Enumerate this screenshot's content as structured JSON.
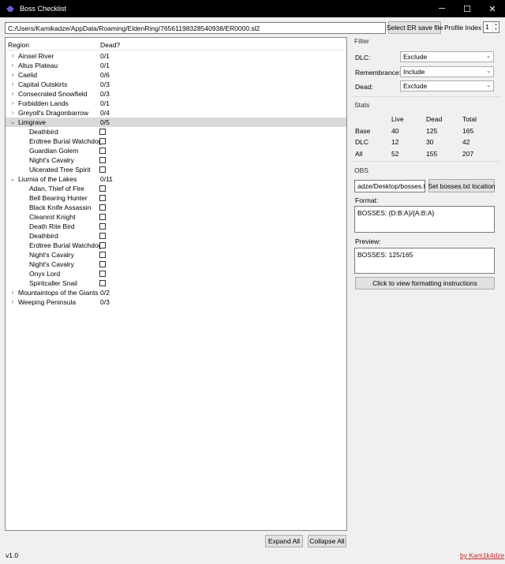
{
  "window": {
    "title": "Boss Checklist",
    "controls": [
      "─",
      "☐",
      "✕"
    ]
  },
  "toolbar": {
    "save_path": "C:/Users/Kamikadze/AppData/Roaming/EldenRing/76561198328540938/ER0000.sl2",
    "select_button": "Select ER save file",
    "profile_label": "Profile Index",
    "profile_value": "1"
  },
  "tree": {
    "headers": {
      "region": "Region",
      "dead": "Dead?"
    },
    "regions": [
      {
        "name": "Ainsel River",
        "count": "0/1",
        "expanded": false
      },
      {
        "name": "Altus Plateau",
        "count": "0/1",
        "expanded": false
      },
      {
        "name": "Caelid",
        "count": "0/6",
        "expanded": false
      },
      {
        "name": "Capital Outskirts",
        "count": "0/3",
        "expanded": false
      },
      {
        "name": "Consecrated Snowfield",
        "count": "0/3",
        "expanded": false
      },
      {
        "name": "Forbidden Lands",
        "count": "0/1",
        "expanded": false
      },
      {
        "name": "Greyoll's Dragonbarrow",
        "count": "0/4",
        "expanded": false
      },
      {
        "name": "Limgrave",
        "count": "0/5",
        "expanded": true,
        "selected": true,
        "bosses": [
          "Deathbird",
          "Erdtree Burial Watchdog",
          "Guardian Golem",
          "Night's Cavalry",
          "Ulcerated Tree Spirit"
        ]
      },
      {
        "name": "Liurnia of the Lakes",
        "count": "0/11",
        "expanded": true,
        "bosses": [
          "Adan, Thief of Fire",
          "Bell Bearing Hunter",
          "Black Knife Assassin",
          "Cleanrot Knight",
          "Death Rite Bird",
          "Deathbird",
          "Erdtree Burial Watchdog",
          "Night's Cavalry",
          "Night's Cavalry",
          "Onyx Lord",
          "Spiritcaller Snail"
        ]
      },
      {
        "name": "Mountaintops of the Giants",
        "count": "0/2",
        "expanded": false
      },
      {
        "name": "Weeping Peninsula",
        "count": "0/3",
        "expanded": false
      }
    ],
    "expand_all": "Expand All",
    "collapse_all": "Collapse All"
  },
  "filter": {
    "title": "Filter",
    "dlc_label": "DLC:",
    "dlc_value": "Exclude",
    "remembrance_label": "Remembrance:",
    "remembrance_value": "Include",
    "dead_label": "Dead:",
    "dead_value": "Exclude"
  },
  "stats": {
    "title": "Stats",
    "columns": [
      "Live",
      "Dead",
      "Total"
    ],
    "rows": [
      {
        "label": "Base",
        "live": "40",
        "dead": "125",
        "total": "165"
      },
      {
        "label": "DLC",
        "live": "12",
        "dead": "30",
        "total": "42"
      },
      {
        "label": "All",
        "live": "52",
        "dead": "155",
        "total": "207"
      }
    ]
  },
  "obs": {
    "title": "OBS",
    "file_path": "adze/Desktop/bosses.txt",
    "set_location_button": "Set bosses.txt location",
    "format_label": "Format:",
    "format_value": "BOSSES: {D:B:A}/{A:B:A}",
    "preview_label": "Preview:",
    "preview_value": "BOSSES: 125/165",
    "instructions_button": "Click to view formatting instructions"
  },
  "footer": {
    "version": "v1.0",
    "author_link": "by Kam1k4dze"
  },
  "colors": {
    "titlebar": "#000000",
    "link": "#c62828",
    "selection": "#d9d9d9"
  }
}
